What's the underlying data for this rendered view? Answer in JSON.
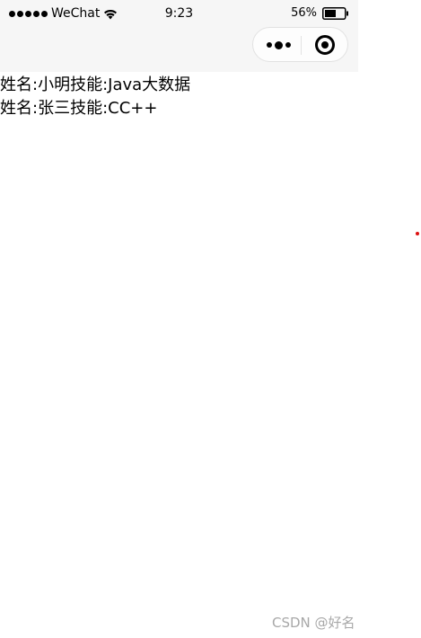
{
  "status_bar": {
    "carrier": "WeChat",
    "time": "9:23",
    "battery": "56%"
  },
  "capsule": {
    "more_icon": "more-dots-icon",
    "close_icon": "target-circle-icon"
  },
  "list": [
    {
      "name_label": "姓名:",
      "name": "小明",
      "skill_label": "技能:",
      "skill": "Java大数据"
    },
    {
      "name_label": "姓名:",
      "name": "张三",
      "skill_label": "技能:",
      "skill": "CC++"
    }
  ],
  "watermark": "CSDN @好名",
  "colors": {
    "status_bg": "#f6f6f6",
    "page_bg": "#ffffff",
    "watermark": "#a8a8a8",
    "red_dot": "#dd1111"
  }
}
